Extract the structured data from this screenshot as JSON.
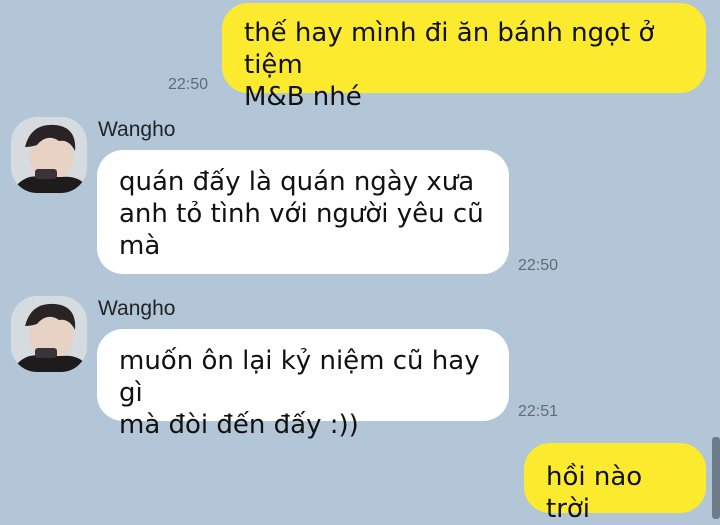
{
  "messages": [
    {
      "side": "sent",
      "text": "thế hay mình đi ăn bánh ngọt ở tiệm\nM&B nhé",
      "time": "22:50"
    },
    {
      "side": "recv",
      "sender": "Wangho",
      "text": "quán đấy là quán ngày xưa\nanh tỏ tình với người yêu cũ\nmà",
      "time": "22:50"
    },
    {
      "side": "recv",
      "sender": "Wangho",
      "text": "muốn ôn lại kỷ niệm cũ hay gì\nmà đòi đến đấy :))",
      "time": "22:51"
    },
    {
      "side": "sent",
      "text": "hồi nào trời"
    }
  ],
  "colors": {
    "background": "#b3c6d8",
    "sent_bubble": "#fbea2e",
    "received_bubble": "#ffffff"
  }
}
